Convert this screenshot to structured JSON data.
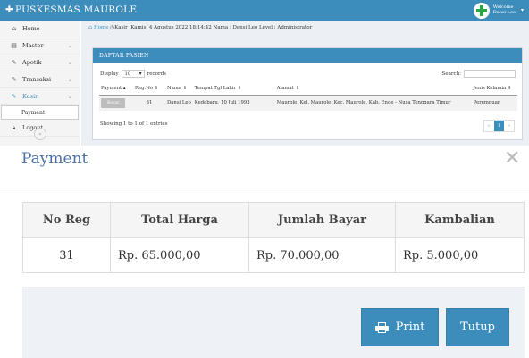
{
  "app": {
    "title": "PUSKESMAS MAUROLE",
    "user_greeting": "Welcome",
    "user_name": "Dansi Leo"
  },
  "sidebar": {
    "items": [
      {
        "label": "Home",
        "icon": "home-icon"
      },
      {
        "label": "Master",
        "icon": "table-icon"
      },
      {
        "label": "Apotik",
        "icon": "edit-icon"
      },
      {
        "label": "Transaksi",
        "icon": "edit-icon"
      },
      {
        "label": "Kasir",
        "icon": "edit-icon"
      }
    ],
    "sub_item": "Payment",
    "logout": "Logout",
    "collapse_glyph": "«"
  },
  "breadcrumb": {
    "home": "Home",
    "page": "Kasir",
    "info": "Kamis, 4 Agustus 2022 18:14:42 Nama : Dansi Leo Level : Administrator"
  },
  "patients": {
    "box_title": "DAFTAR PASIEN",
    "display_label": "Display",
    "display_value": "10",
    "records_label": "records",
    "search_label": "Search:",
    "columns": [
      "Payment",
      "Reg.No",
      "Nama",
      "Tempat Tgl Lahir",
      "Alamat",
      "Jenis Kelamin"
    ],
    "rows": [
      {
        "payment_button": "Bayar",
        "reg_no": "31",
        "nama": "Dansi Leo",
        "ttl": "Kedebaru, 10 Juli 1993",
        "alamat": "Maurole, Kel. Maurole, Kec. Maurole, Kab. Ende - Nusa Tenggara Timur",
        "jenis_kelamin": "Perempuan"
      }
    ],
    "showing": "Showing 1 to 1 of 1 entries",
    "pager": [
      "«",
      "1",
      "»"
    ]
  },
  "modal": {
    "title": "Payment",
    "close_glyph": "✕",
    "columns": [
      "No Reg",
      "Total Harga",
      "Jumlah Bayar",
      "Kambalian"
    ],
    "row": {
      "no_reg": "31",
      "total_harga": "Rp. 65.000,00",
      "jumlah_bayar": "Rp. 70.000,00",
      "kembalian": "Rp. 5.000,00"
    },
    "print_label": "Print",
    "close_label": "Tutup"
  },
  "colors": {
    "primary": "#3c8dbc",
    "sidebar_bg": "#f4f4f4",
    "content_bg": "#ecf0f5",
    "modal_title": "#4a6fa5"
  }
}
